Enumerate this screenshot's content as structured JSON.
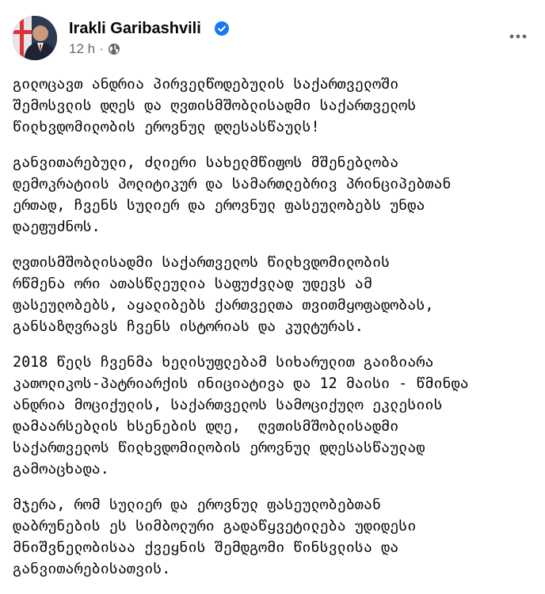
{
  "author": {
    "name": "Irakli Garibashvili",
    "verified_icon": "verified-badge-icon",
    "avatar_icon": "profile-photo"
  },
  "meta": {
    "timestamp": "12 h",
    "separator": "·",
    "audience_icon": "globe-icon"
  },
  "more_options_icon": "more-horizontal-icon",
  "colors": {
    "text": "#050505",
    "secondary_text": "#65676b",
    "verified_blue": "#1877f2",
    "background": "#ffffff"
  },
  "post": {
    "paragraphs": [
      "გილოცავთ ანდრია პირველწოდებულის საქართველოში\nშემოსვლის დღეს და ღვთისმშობლისადმი საქართველოს\nწილხვდომილობის ეროვნულ დღესასწაულს!",
      "განვითარებული, ძლიერი სახელმწიფოს მშენებლობა\nდემოკრატიის პოლიტიკურ და სამართლებრივ პრინციპებთან\nერთად, ჩვენს სულიერ და ეროვნულ ფასეულობებს უნდა\nდაეფუძნოს.",
      "ღვთისმშობლისადმი საქართველოს წილხვდომილობის\nრწმენა ორი ათასწლეულია საფუძვლად უდევს ამ\nფასეულობებს, აყალიბებს ქართველთა თვითმყოფადობას,\nგანსაზღვრავს ჩვენს ისტორიას და კულტურას.",
      "2018 წელს ჩვენმა ხელისუფლებამ სიხარულით გაიზიარა\nკათოლიკოს-პატრიარქის ინიციატივა და 12 მაისი - წმინდა\nანდრია მოციქულის, საქართველოს სამოციქულო ეკლესიის\nდამაარსებლის ხსენების დღე,  ღვთისმშობლისადმი\nსაქართველოს წილხვდომილობის ეროვნულ დღესასწაულად\nგამოაცხადა.",
      "მჯერა, რომ სულიერ და ეროვნულ ფასეულობებთან\nდაბრუნების ეს სიმბოლური გადაწყვეტილება უდიდესი\nმნიშვნელობისაა ქვეყნის შემდგომი წინსვლისა და\nგანვითარებისათვის."
    ]
  }
}
